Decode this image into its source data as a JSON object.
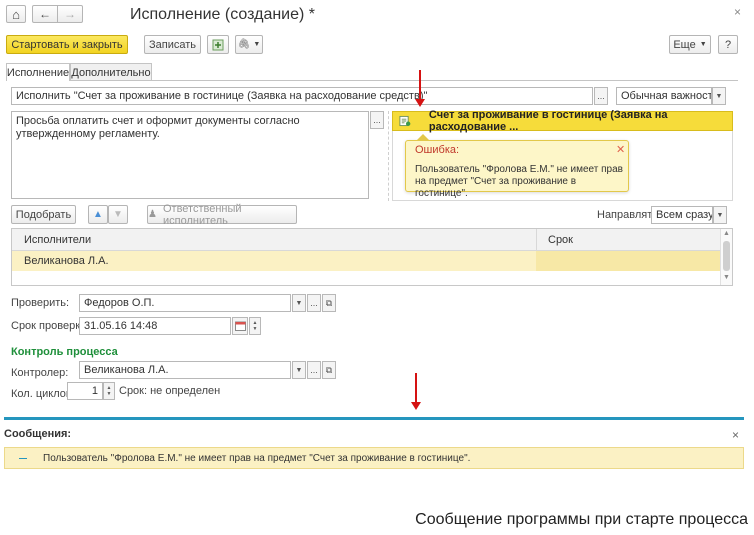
{
  "window": {
    "title": "Исполнение (создание) *",
    "close_glyph": "×"
  },
  "nav": {
    "home_glyph": "⌂",
    "back_glyph": "←",
    "forward_glyph": "→"
  },
  "toolbar": {
    "start_close_label": "Стартовать и закрыть",
    "save_label": "Записать",
    "more_label": "Еще",
    "help_label": "?"
  },
  "tabs": [
    {
      "label": "Исполнение",
      "active": true
    },
    {
      "label": "Дополнительно",
      "active": false
    }
  ],
  "task": {
    "title_value": "Исполнить \"Счет за проживание в гостинице (Заявка на расходование средств)\"",
    "importance_value": "Обычная важность",
    "description": "Просьба оплатить счет и оформит документы согласно утвержденному регламенту.",
    "subject_link": "Счет за проживание в гостинице (Заявка на расходование ..."
  },
  "error_popup": {
    "title": "Ошибка:",
    "message": "Пользователь \"Фролова Е.М.\" не имеет прав на предмет \"Счет за проживание в гостинице\"."
  },
  "performers": {
    "pick_label": "Подобрать",
    "responsible_label": "Ответственный исполнитель",
    "send_label": "Направлять:",
    "send_value": "Всем сразу",
    "columns": [
      "Исполнители",
      "Срок"
    ],
    "rows": [
      {
        "performer": "Великанова Л.А.",
        "deadline": ""
      }
    ]
  },
  "check": {
    "checker_label": "Проверить:",
    "checker_value": "Федоров О.П.",
    "date_label": "Срок проверки:",
    "date_value": "31.05.16 14:48"
  },
  "control": {
    "section_title": "Контроль процесса",
    "controller_label": "Контролер:",
    "controller_value": "Великанова Л.А.",
    "cycles_label": "Кол. циклов:",
    "cycles_value": "1",
    "cycles_deadline": "Срок: не определен"
  },
  "messages": {
    "title": "Сообщения:",
    "close_glyph": "×",
    "items": [
      "Пользователь \"Фролова Е.М.\" не имеет прав на предмет \"Счет за проживание в гостинице\"."
    ]
  },
  "caption": "Сообщение программы при старте процесса",
  "colors": {
    "accent_yellow": "#f6dc3a",
    "link_blue": "#2596be",
    "error_red": "#c0392b",
    "green_section": "#1e8f3a",
    "arrow_red": "#d51212"
  }
}
